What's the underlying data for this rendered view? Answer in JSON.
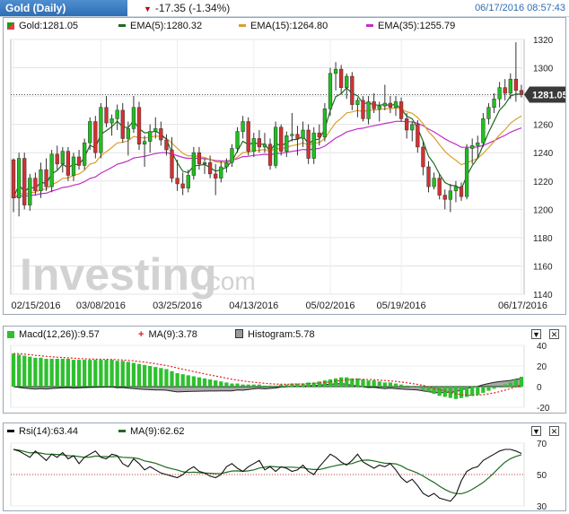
{
  "header": {
    "instrument_tab": "Gold (Daily)",
    "change_text": "-17.35 (-1.34%)",
    "timestamp": "06/17/2016 08:57:43"
  },
  "price_panel": {
    "legend": [
      {
        "label": "Gold:1281.05",
        "color": "#1a9b1a"
      },
      {
        "label": "EMA(5):1280.32",
        "color": "#1e6b1e"
      },
      {
        "label": "EMA(15):1264.80",
        "color": "#d9a02a"
      },
      {
        "label": "EMA(35):1255.79",
        "color": "#c030c8"
      }
    ],
    "last_price_tag": "1281.05",
    "watermark": "Investing",
    "watermark_suffix": ".com"
  },
  "macd_panel": {
    "legend": [
      {
        "label": "Macd(12,26)):9.57",
        "color": "#2ec02e",
        "icon": "square"
      },
      {
        "label": "MA(9):3.78",
        "color": "#e02020",
        "icon": "plus"
      },
      {
        "label": "Histogram:5.78",
        "color": "#9a9a9a",
        "icon": "square"
      }
    ],
    "controls": [
      "▼",
      "✕"
    ]
  },
  "rsi_panel": {
    "legend": [
      {
        "label": "Rsi(14):63.44",
        "color": "#111111",
        "icon": "line"
      },
      {
        "label": "MA(9):62.62",
        "color": "#1e6b1e",
        "icon": "line"
      }
    ],
    "controls": [
      "▼",
      "✕"
    ]
  },
  "chart_data": [
    {
      "type": "candlestick",
      "title": "Gold (Daily)",
      "ylim": [
        1140,
        1320
      ],
      "y_ticks": [
        1140,
        1160,
        1180,
        1200,
        1220,
        1240,
        1260,
        1280,
        1300,
        1320
      ],
      "x_tick_labels": [
        "02/15/2016",
        "03/08/2016",
        "03/25/2016",
        "04/13/2016",
        "05/02/2016",
        "05/19/2016",
        "06/17/2016"
      ],
      "x_tick_indices": [
        0,
        16,
        30,
        44,
        58,
        71,
        93
      ],
      "last_value": 1281.05,
      "candles": [
        [
          1235,
          1236,
          1198,
          1208
        ],
        [
          1208,
          1240,
          1195,
          1236
        ],
        [
          1236,
          1240,
          1200,
          1203
        ],
        [
          1203,
          1225,
          1199,
          1222
        ],
        [
          1222,
          1226,
          1210,
          1213
        ],
        [
          1213,
          1233,
          1208,
          1228
        ],
        [
          1228,
          1236,
          1213,
          1216
        ],
        [
          1216,
          1242,
          1212,
          1239
        ],
        [
          1239,
          1245,
          1228,
          1232
        ],
        [
          1232,
          1244,
          1226,
          1241
        ],
        [
          1241,
          1244,
          1220,
          1224
        ],
        [
          1224,
          1240,
          1220,
          1237
        ],
        [
          1237,
          1242,
          1228,
          1231
        ],
        [
          1231,
          1250,
          1228,
          1247
        ],
        [
          1247,
          1265,
          1242,
          1262
        ],
        [
          1262,
          1266,
          1236,
          1240
        ],
        [
          1240,
          1275,
          1236,
          1272
        ],
        [
          1272,
          1280,
          1258,
          1261
        ],
        [
          1261,
          1267,
          1252,
          1264
        ],
        [
          1264,
          1274,
          1256,
          1270
        ],
        [
          1270,
          1275,
          1247,
          1250
        ],
        [
          1250,
          1262,
          1238,
          1257
        ],
        [
          1257,
          1280,
          1254,
          1272
        ],
        [
          1272,
          1276,
          1242,
          1246
        ],
        [
          1246,
          1252,
          1230,
          1248
        ],
        [
          1248,
          1260,
          1240,
          1255
        ],
        [
          1255,
          1265,
          1250,
          1257
        ],
        [
          1257,
          1262,
          1245,
          1249
        ],
        [
          1249,
          1253,
          1238,
          1242
        ],
        [
          1242,
          1251,
          1219,
          1222
        ],
        [
          1222,
          1235,
          1213,
          1218
        ],
        [
          1218,
          1226,
          1210,
          1215
        ],
        [
          1215,
          1228,
          1212,
          1224
        ],
        [
          1224,
          1244,
          1221,
          1240
        ],
        [
          1240,
          1244,
          1228,
          1232
        ],
        [
          1232,
          1236,
          1225,
          1233
        ],
        [
          1233,
          1238,
          1222,
          1225
        ],
        [
          1225,
          1232,
          1210,
          1222
        ],
        [
          1222,
          1234,
          1219,
          1230
        ],
        [
          1230,
          1236,
          1226,
          1233
        ],
        [
          1233,
          1246,
          1230,
          1243
        ],
        [
          1243,
          1258,
          1240,
          1255
        ],
        [
          1255,
          1266,
          1250,
          1262
        ],
        [
          1262,
          1265,
          1238,
          1241
        ],
        [
          1241,
          1254,
          1237,
          1250
        ],
        [
          1250,
          1256,
          1240,
          1244
        ],
        [
          1244,
          1254,
          1240,
          1246
        ],
        [
          1246,
          1250,
          1228,
          1231
        ],
        [
          1231,
          1262,
          1229,
          1258
        ],
        [
          1258,
          1260,
          1238,
          1241
        ],
        [
          1241,
          1255,
          1237,
          1252
        ],
        [
          1252,
          1268,
          1248,
          1253
        ],
        [
          1253,
          1259,
          1238,
          1250
        ],
        [
          1250,
          1262,
          1244,
          1256
        ],
        [
          1256,
          1260,
          1232,
          1236
        ],
        [
          1236,
          1258,
          1232,
          1254
        ],
        [
          1254,
          1260,
          1245,
          1251
        ],
        [
          1251,
          1275,
          1248,
          1271
        ],
        [
          1271,
          1300,
          1266,
          1296
        ],
        [
          1296,
          1304,
          1284,
          1299
        ],
        [
          1299,
          1302,
          1281,
          1286
        ],
        [
          1286,
          1296,
          1278,
          1294
        ],
        [
          1294,
          1297,
          1270,
          1274
        ],
        [
          1274,
          1279,
          1265,
          1277
        ],
        [
          1277,
          1280,
          1262,
          1264
        ],
        [
          1264,
          1280,
          1260,
          1276
        ],
        [
          1276,
          1282,
          1268,
          1271
        ],
        [
          1271,
          1276,
          1262,
          1273
        ],
        [
          1273,
          1288,
          1270,
          1275
        ],
        [
          1275,
          1280,
          1268,
          1272
        ],
        [
          1272,
          1280,
          1266,
          1276
        ],
        [
          1276,
          1279,
          1262,
          1264
        ],
        [
          1264,
          1268,
          1250,
          1256
        ],
        [
          1256,
          1262,
          1248,
          1260
        ],
        [
          1260,
          1263,
          1240,
          1244
        ],
        [
          1244,
          1248,
          1224,
          1230
        ],
        [
          1230,
          1234,
          1212,
          1216
        ],
        [
          1216,
          1226,
          1214,
          1222
        ],
        [
          1222,
          1225,
          1207,
          1210
        ],
        [
          1210,
          1214,
          1200,
          1207
        ],
        [
          1207,
          1218,
          1198,
          1213
        ],
        [
          1213,
          1220,
          1205,
          1216
        ],
        [
          1216,
          1219,
          1206,
          1209
        ],
        [
          1209,
          1246,
          1207,
          1243
        ],
        [
          1243,
          1250,
          1232,
          1245
        ],
        [
          1245,
          1252,
          1236,
          1247
        ],
        [
          1247,
          1268,
          1244,
          1264
        ],
        [
          1264,
          1275,
          1260,
          1272
        ],
        [
          1272,
          1282,
          1268,
          1278
        ],
        [
          1278,
          1290,
          1272,
          1286
        ],
        [
          1286,
          1292,
          1277,
          1282
        ],
        [
          1282,
          1296,
          1278,
          1292
        ],
        [
          1292,
          1318,
          1276,
          1284
        ],
        [
          1284,
          1288,
          1279,
          1281.05
        ]
      ]
    },
    {
      "type": "macd",
      "ylim": [
        -20,
        40
      ],
      "y_ticks": [
        -20,
        0,
        20,
        40
      ],
      "macd_last": 9.57,
      "signal_last": 3.78,
      "histogram_last": 5.78,
      "macd_values": [
        32,
        31,
        30,
        29,
        28,
        28,
        27,
        27,
        27,
        27,
        27,
        26,
        26,
        26,
        26,
        26,
        26,
        26,
        26,
        25,
        25,
        24,
        23,
        22,
        21,
        20,
        19,
        18,
        17,
        15,
        13,
        12,
        11,
        10,
        9,
        8,
        7,
        6,
        5,
        4,
        3,
        3,
        2,
        2,
        2,
        2,
        1,
        1,
        1,
        2,
        2,
        3,
        3,
        3,
        4,
        4,
        5,
        6,
        7,
        8,
        9,
        9,
        8,
        8,
        7,
        6,
        6,
        5,
        4,
        4,
        3,
        2,
        1,
        0,
        -1,
        -3,
        -5,
        -7,
        -9,
        -10,
        -11,
        -12,
        -11,
        -10,
        -9,
        -8,
        -6,
        -4,
        -2,
        0,
        2,
        4,
        7,
        9.57
      ]
    },
    {
      "type": "line",
      "title": "Rsi(14)",
      "ylim": [
        30,
        70
      ],
      "y_ticks": [
        30,
        50,
        70
      ],
      "reference_line": 50,
      "rsi_last": 63.44,
      "ma_last": 62.62,
      "rsi_values": [
        66,
        65,
        63,
        61,
        65,
        62,
        59,
        63,
        61,
        64,
        60,
        62,
        57,
        61,
        63,
        65,
        61,
        60,
        63,
        62,
        57,
        55,
        60,
        57,
        53,
        55,
        53,
        51,
        50,
        49,
        48,
        50,
        53,
        55,
        52,
        51,
        49,
        48,
        50,
        55,
        57,
        54,
        52,
        55,
        57,
        59,
        53,
        55,
        52,
        55,
        54,
        52,
        53,
        56,
        52,
        50,
        55,
        59,
        63,
        61,
        58,
        56,
        59,
        63,
        58,
        56,
        54,
        56,
        55,
        57,
        53,
        48,
        45,
        47,
        43,
        38,
        36,
        38,
        35,
        34,
        33,
        37,
        46,
        52,
        54,
        55,
        59,
        61,
        63,
        65,
        66,
        66,
        65,
        63.44
      ]
    }
  ]
}
